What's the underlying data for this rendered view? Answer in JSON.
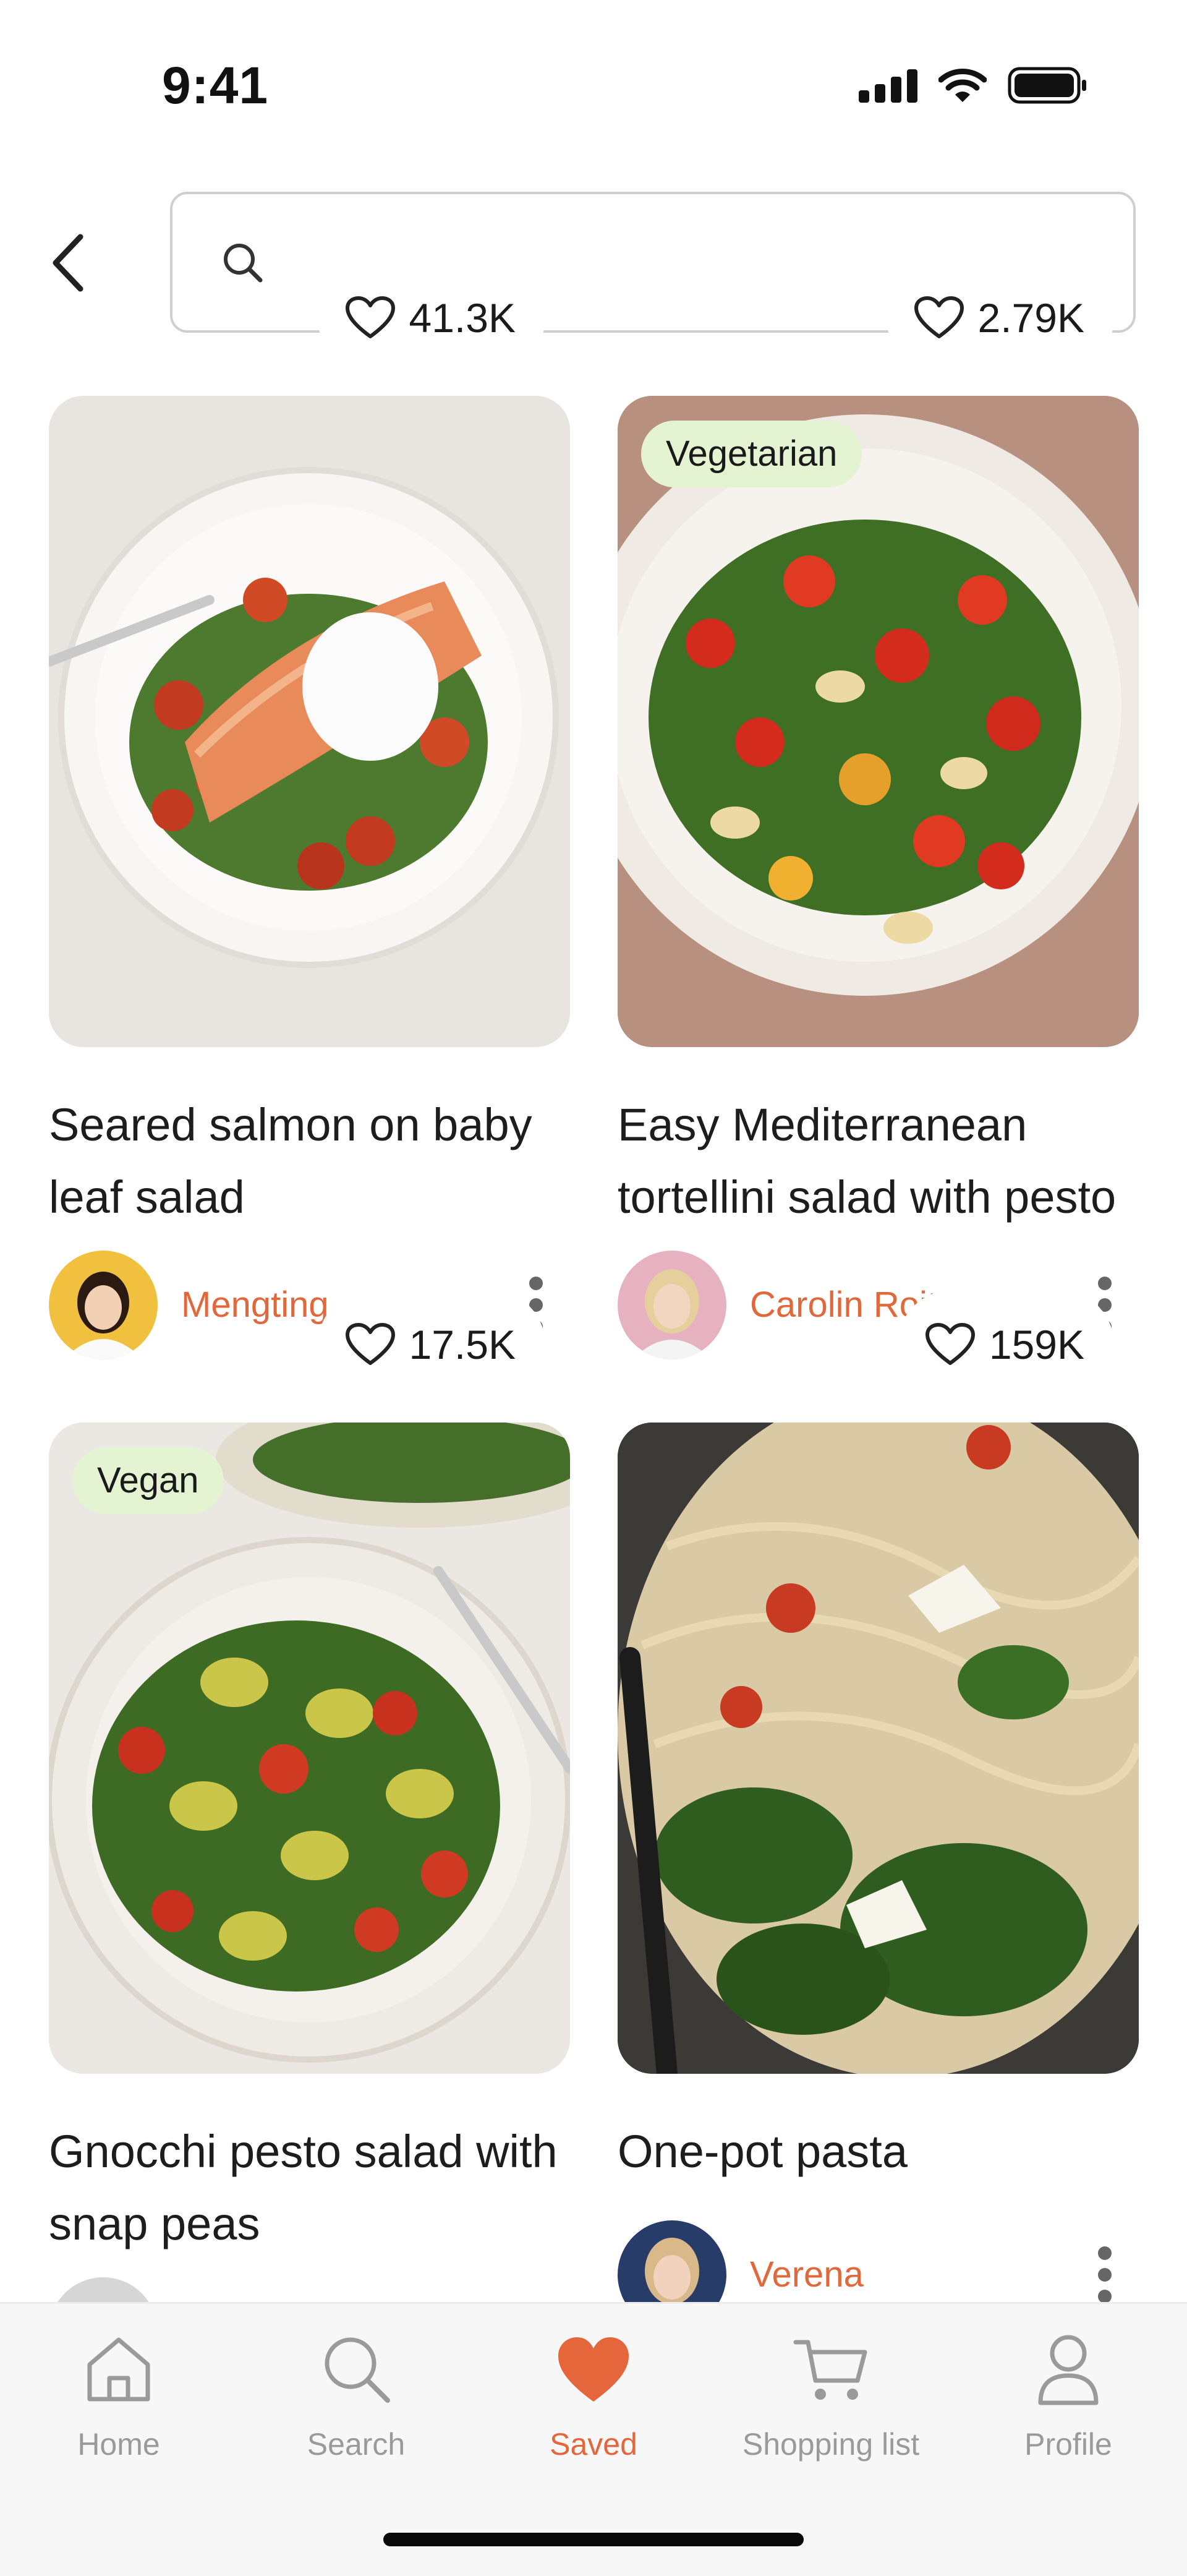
{
  "status_bar": {
    "time": "9:41"
  },
  "search": {
    "placeholder": "",
    "value": ""
  },
  "recipes": [
    {
      "title": "Seared salmon on baby leaf salad",
      "tag": "",
      "likes": "41.3K",
      "author": "Mengting"
    },
    {
      "title": "Easy Mediterranean tortellini salad with pesto",
      "tag": "Vegetarian",
      "likes": "2.79K",
      "author": "Carolin Roitzheim"
    },
    {
      "title": "Gnocchi pesto salad with snap peas",
      "tag": "Vegan",
      "likes": "17.5K",
      "author": ""
    },
    {
      "title": "One-pot pasta",
      "tag": "",
      "likes": "159K",
      "author": "Verena"
    }
  ],
  "tabbar": {
    "home": "Home",
    "search": "Search",
    "saved": "Saved",
    "shopping": "Shopping list",
    "profile": "Profile"
  },
  "colors": {
    "accent": "#e5663a",
    "tag_bg": "#e4f3d2",
    "tab_inactive": "#9a9a9a"
  },
  "icons": [
    "back-arrow-icon",
    "search-icon",
    "heart-outline-icon",
    "more-vertical-icon",
    "home-icon",
    "heart-filled-icon",
    "cart-icon",
    "person-icon"
  ]
}
